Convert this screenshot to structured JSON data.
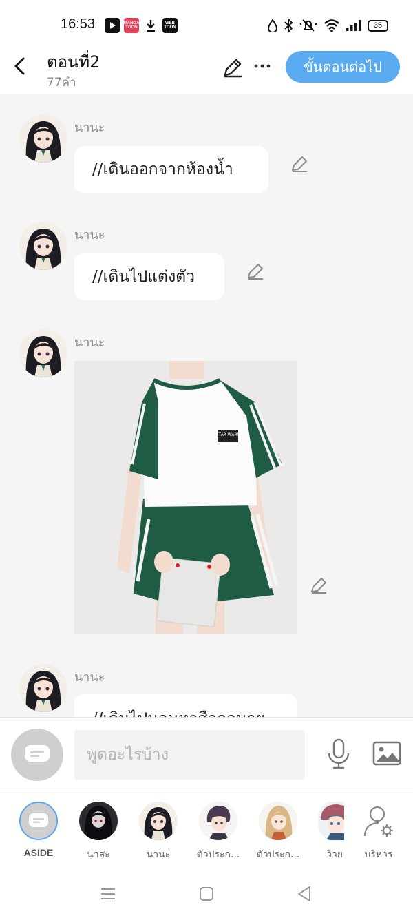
{
  "status": {
    "time": "16:53",
    "battery": "35",
    "apps": [
      "youtube",
      "MANGA TOON",
      "download",
      "WEB TOON"
    ]
  },
  "header": {
    "title": "ตอนที่2",
    "word_count": "77คำ",
    "next_button": "ขั้นตอนต่อไป"
  },
  "messages": [
    {
      "sender": "นานะ",
      "text": "//เดินออกจากห้องน้ำ"
    },
    {
      "sender": "นานะ",
      "text": "//เดินไปแต่งตัว"
    },
    {
      "sender": "นานะ",
      "image": "white-green-raglan-tshirt-and-green-striped-shorts",
      "shirt_print": "STAR WARS"
    },
    {
      "sender": "นานะ",
      "text": "//เดินไปนอนหาสือออนาย"
    }
  ],
  "input": {
    "placeholder": "พูดอะไรบ้าง"
  },
  "characters": [
    {
      "label": "ASIDE",
      "selected": true
    },
    {
      "label": "นาสะ"
    },
    {
      "label": "นานะ"
    },
    {
      "label": "ตัวประก..."
    },
    {
      "label": "ตัวประก..."
    },
    {
      "label": "วิวย"
    },
    {
      "label": "บริหาร"
    }
  ],
  "colors": {
    "accent": "#5aaaf0",
    "chat_bg": "#f5f5f5",
    "shirt_green": "#1f5c44"
  }
}
